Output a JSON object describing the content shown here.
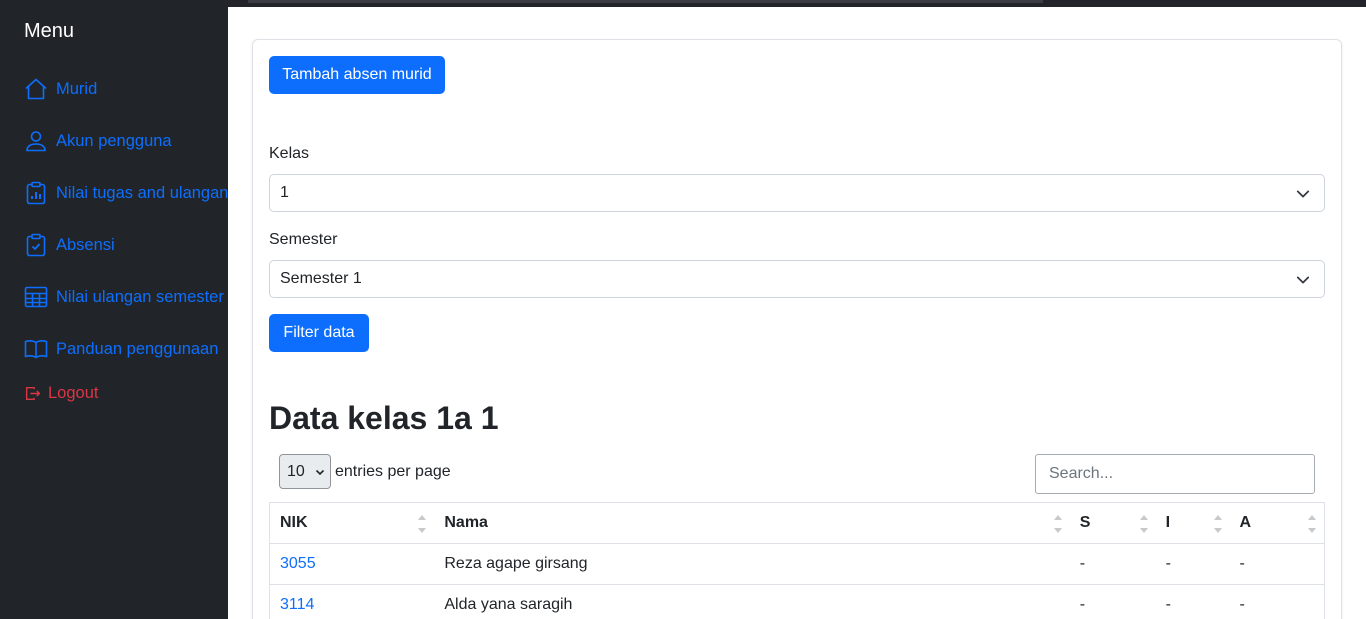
{
  "sidebar": {
    "title": "Menu",
    "items": [
      {
        "label": "Murid",
        "icon": "house-icon"
      },
      {
        "label": "Akun pengguna",
        "icon": "person-icon"
      },
      {
        "label": "Nilai tugas and ulangan",
        "icon": "clipboard-data-icon"
      },
      {
        "label": "Absensi",
        "icon": "clipboard-check-icon"
      },
      {
        "label": "Nilai ulangan semester",
        "icon": "table-icon"
      },
      {
        "label": "Panduan penggunaan",
        "icon": "book-icon"
      }
    ],
    "logout": {
      "label": "Logout",
      "icon": "box-arrow-right-icon"
    }
  },
  "main": {
    "add_button": "Tambah absen murid",
    "kelas_label": "Kelas",
    "kelas_value": "1",
    "semester_label": "Semester",
    "semester_value": "Semester 1",
    "filter_button": "Filter data",
    "heading": "Data kelas 1a 1",
    "entries_value": "10",
    "entries_label": "entries per page",
    "search_placeholder": "Search..."
  },
  "table": {
    "columns": [
      "NIK",
      "Nama",
      "S",
      "I",
      "A"
    ],
    "rows": [
      {
        "nik": "3055",
        "nama": "Reza agape girsang",
        "s": "-",
        "i": "-",
        "a": "-"
      },
      {
        "nik": "3114",
        "nama": "Alda yana saragih",
        "s": "-",
        "i": "-",
        "a": "-"
      }
    ]
  },
  "colors": {
    "sidebar_bg": "#212529",
    "primary": "#0d6efd",
    "danger": "#dc3545"
  }
}
